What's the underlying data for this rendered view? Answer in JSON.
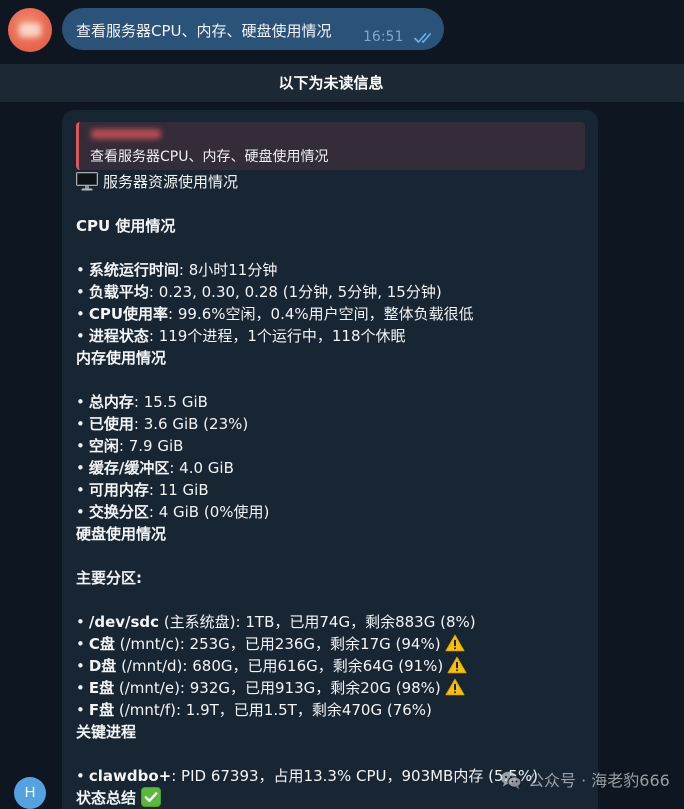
{
  "outgoing_message": {
    "text": "查看服务器CPU、内存、硬盘使用情况",
    "time": "16:51",
    "status_icon": "double-check-icon",
    "bubble_color": "#2b5278"
  },
  "unread_divider": {
    "label": "以下为未读信息"
  },
  "incoming_message": {
    "reply_quote": {
      "text": "查看服务器CPU、内存、硬盘使用情况",
      "accent_color": "#e0575b"
    },
    "heading": {
      "icon": "desktop-computer-icon",
      "text": "服务器资源使用情况"
    },
    "bullet": "•",
    "cpu": {
      "title": "CPU 使用情况",
      "items": [
        {
          "label": "系统运行时间",
          "value": ": 8小时11分钟"
        },
        {
          "label": "负载平均",
          "value": ": 0.23, 0.30, 0.28 (1分钟, 5分钟, 15分钟)"
        },
        {
          "label": "CPU使用率",
          "value": ": 99.6%空闲，0.4%用户空间，整体负载很低"
        },
        {
          "label": "进程状态",
          "value": ": 119个进程，1个运行中，118个休眠"
        }
      ]
    },
    "memory": {
      "title": "内存使用情况",
      "items": [
        {
          "label": "总内存",
          "value": ": 15.5 GiB"
        },
        {
          "label": "已使用",
          "value": ": 3.6 GiB (23%)"
        },
        {
          "label": "空闲",
          "value": ": 7.9 GiB"
        },
        {
          "label": "缓存/缓冲区",
          "value": ": 4.0 GiB"
        },
        {
          "label": "可用内存",
          "value": ": 11 GiB"
        },
        {
          "label": "交换分区",
          "value": ": 4 GiB (0%使用)"
        }
      ]
    },
    "disk": {
      "title": "硬盘使用情况",
      "subtitle": "主要分区:",
      "partitions": [
        {
          "label": "/dev/sdc",
          "value": " (主系统盘): 1TB，已用74G，剩余883G (8%)",
          "icon": null
        },
        {
          "label": "C盘",
          "value": " (/mnt/c): 253G，已用236G，剩余17G (94%)",
          "icon": "warning-icon"
        },
        {
          "label": "D盘",
          "value": " (/mnt/d): 680G，已用616G，剩余64G (91%)",
          "icon": "warning-icon"
        },
        {
          "label": "E盘",
          "value": " (/mnt/e): 932G，已用913G，剩余20G (98%)",
          "icon": "warning-icon"
        },
        {
          "label": "F盘",
          "value": " (/mnt/f): 1.9T，已用1.5T，剩余470G (76%)",
          "icon": null
        }
      ]
    },
    "processes": {
      "title": "关键进程",
      "items": [
        {
          "label": "clawdbo+",
          "value": ": PID 67393，占用13.3% CPU，903MB内存 (5.5%)"
        }
      ]
    },
    "summary": {
      "title": "状态总结",
      "icon": "check-mark-button-icon"
    }
  },
  "sender_avatar": {
    "initial": "H",
    "color": "#54a3e0"
  },
  "watermark": {
    "icon": "wechat-icon",
    "text": "公众号 · 海老豹666"
  },
  "theme": {
    "background": "#0e1621",
    "incoming_bubble": "#182533",
    "divider_band": "#1c2834",
    "time_color": "#7da8d3",
    "warning_color": "#f4c20d",
    "ok_color": "#5cb83c"
  }
}
